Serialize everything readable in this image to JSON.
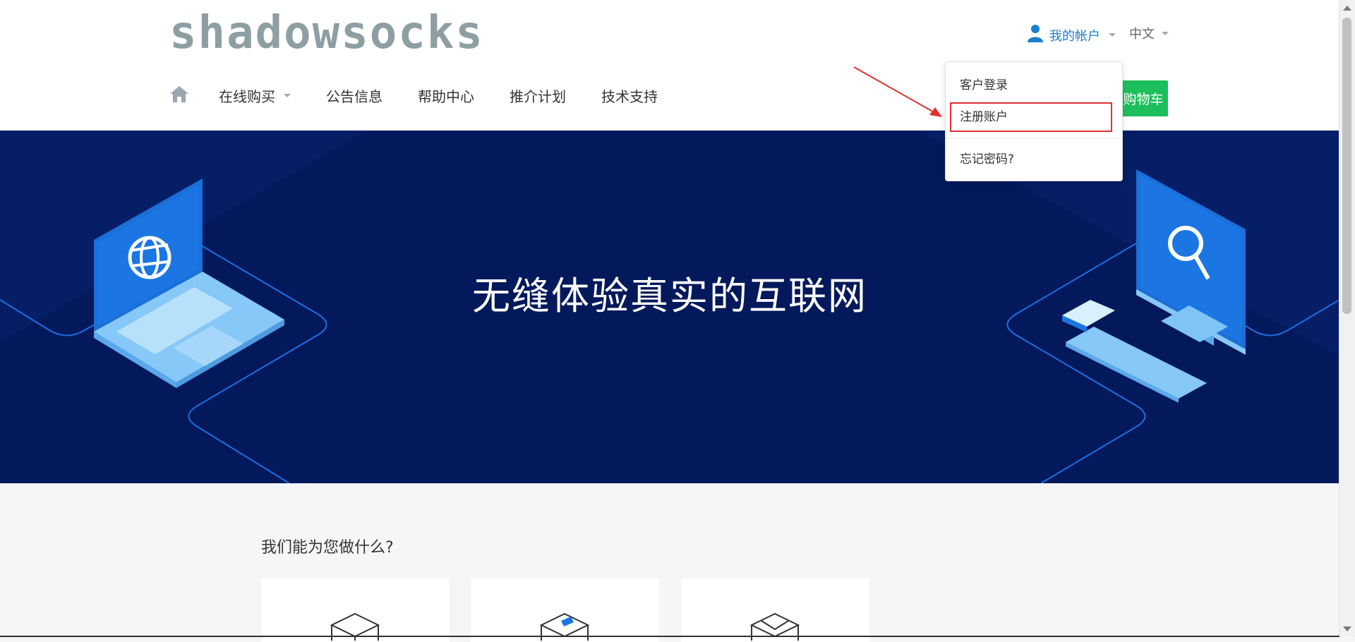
{
  "header": {
    "logo_text": "shadowsocks",
    "account_label": "我的帐户",
    "language_label": "中文",
    "cart_button_label": "购物车"
  },
  "nav": {
    "items": [
      {
        "label": "在线购买"
      },
      {
        "label": "公告信息"
      },
      {
        "label": "帮助中心"
      },
      {
        "label": "推介计划"
      },
      {
        "label": "技术支持"
      }
    ]
  },
  "account_dropdown": {
    "items": [
      {
        "label": "客户登录"
      },
      {
        "label": "注册账户"
      },
      {
        "label": "忘记密码?"
      }
    ]
  },
  "hero": {
    "title": "无缝体验真实的互联网"
  },
  "services": {
    "title": "我们能为您做什么?"
  },
  "colors": {
    "accent": "#1b7fcc",
    "cart": "#1dbf5c",
    "hero_bg": "#04195b",
    "annotation_red": "#e03131"
  }
}
